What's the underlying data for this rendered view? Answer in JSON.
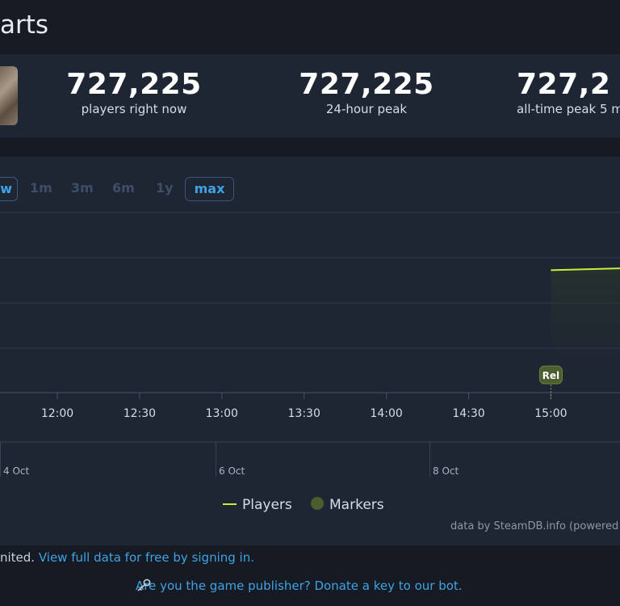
{
  "header": {
    "title": "arts"
  },
  "stats": [
    {
      "value": "727,225",
      "label": "players right now"
    },
    {
      "value": "727,225",
      "label": "24-hour peak"
    },
    {
      "value": "727,2",
      "label": "all-time peak 5 m"
    }
  ],
  "ranges": [
    "w",
    "1m",
    "3m",
    "6m",
    "1y",
    "max"
  ],
  "chart_data": {
    "type": "area",
    "x_ticks": [
      "12:00",
      "12:30",
      "13:00",
      "13:30",
      "14:00",
      "14:30",
      "15:00"
    ],
    "nav_ticks": [
      "4 Oct",
      "6 Oct",
      "8 Oct"
    ],
    "series": [
      {
        "name": "Players",
        "color": "#c6ef3a",
        "start_x": "15:00",
        "start_value_fraction": 0.68,
        "end_value_fraction": 0.69
      }
    ],
    "markers": [
      {
        "label": "Rel",
        "x": "15:00"
      }
    ],
    "legend": {
      "players": "Players",
      "markers": "Markers",
      "placement": "bottom-center"
    },
    "credit": "data by SteamDB.info (powered b",
    "grid": true
  },
  "footer": {
    "note_prefix": "nited.",
    "note_link": "View full data for free by signing in.",
    "bot_link": "Are you the game publisher? Donate a key to our bot."
  },
  "colors": {
    "accent": "#3fa3e6",
    "players": "#c6ef3a",
    "marker": "#4a5e2e"
  }
}
